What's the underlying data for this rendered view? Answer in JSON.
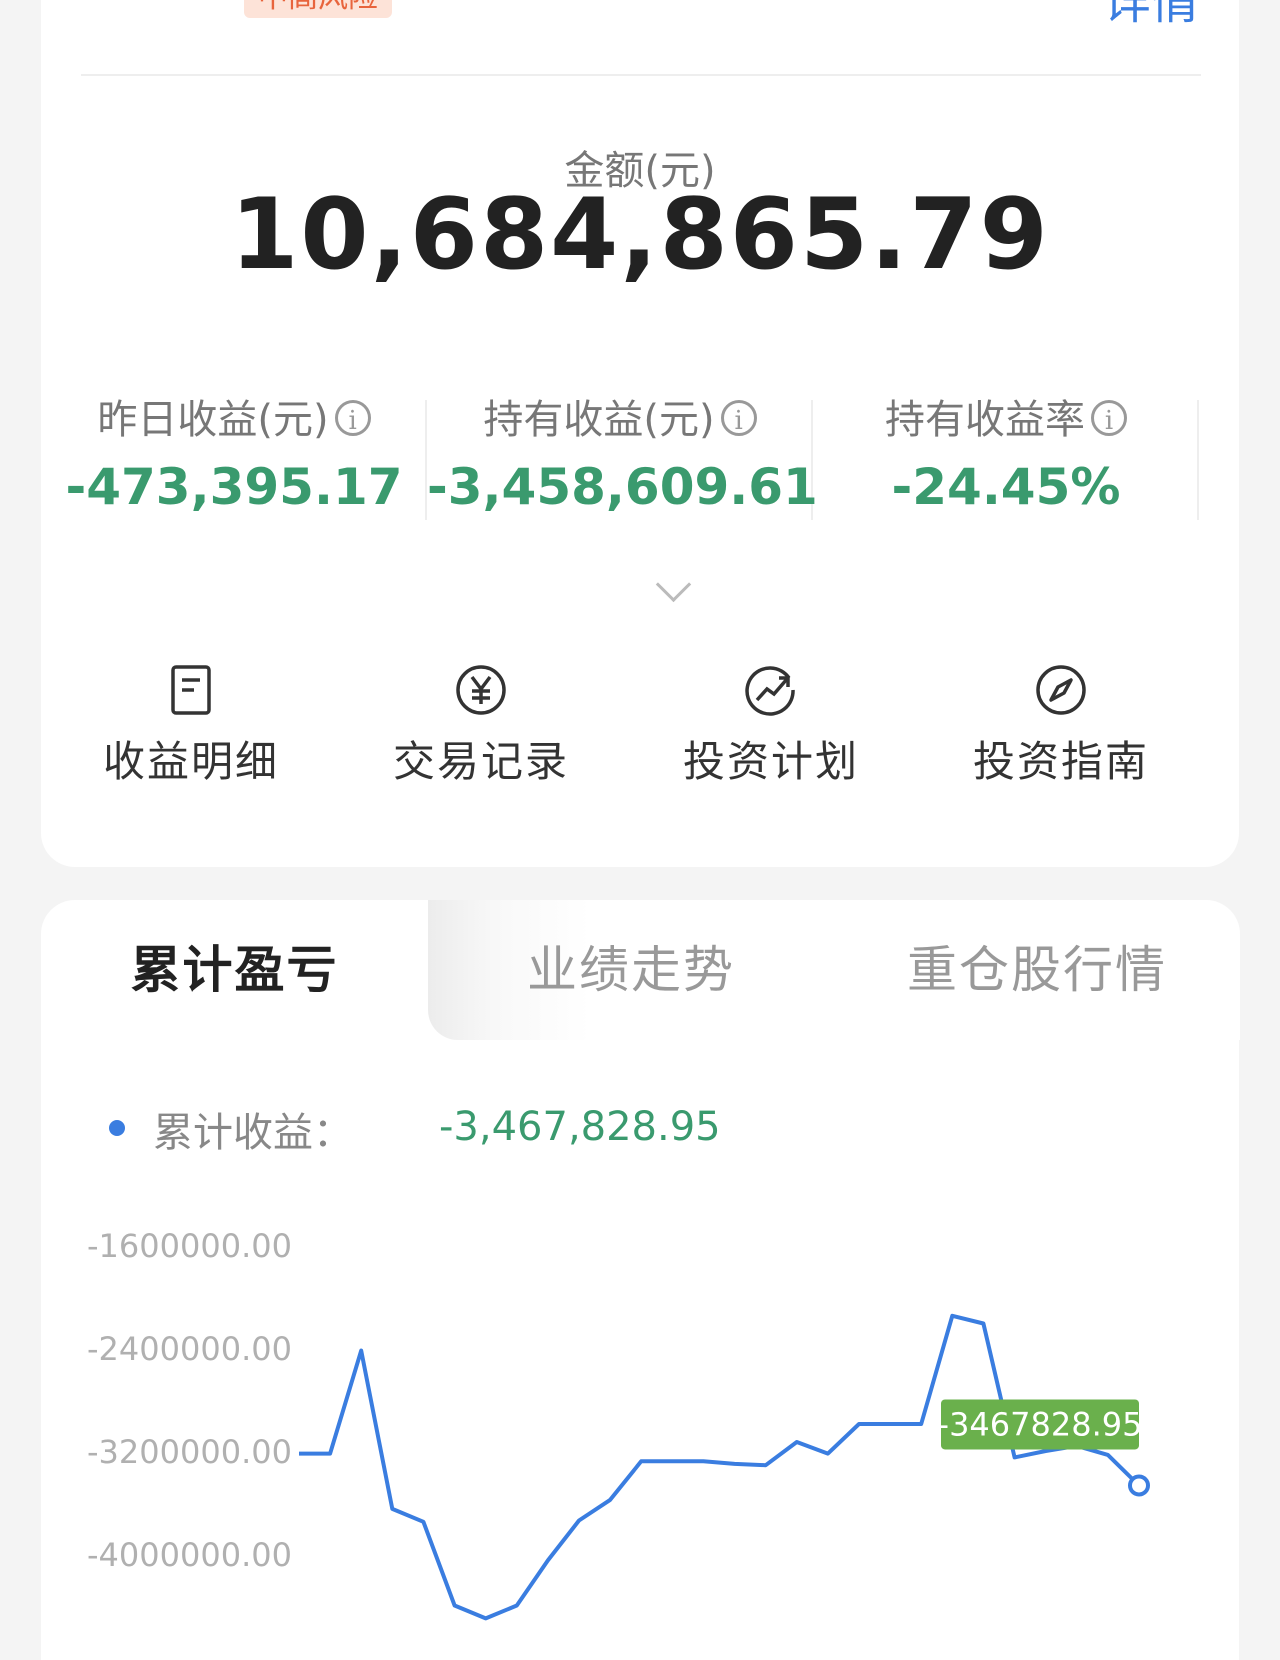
{
  "header": {
    "risk_badge": "中高风险",
    "detail_link": "详情"
  },
  "summary": {
    "amount_label": "金额(元)",
    "amount_value": "10,684,865.79",
    "stats": [
      {
        "label": "昨日收益(元)",
        "value": "-473,395.17"
      },
      {
        "label": "持有收益(元)",
        "value": "-3,458,609.61"
      },
      {
        "label": "持有收益率",
        "value": "-24.45%"
      }
    ]
  },
  "actions": [
    {
      "label": "收益明细",
      "icon": "document-icon"
    },
    {
      "label": "交易记录",
      "icon": "yen-circle-icon"
    },
    {
      "label": "投资计划",
      "icon": "trend-up-icon"
    },
    {
      "label": "投资指南",
      "icon": "compass-icon"
    }
  ],
  "tabs": [
    {
      "label": "累计盈亏",
      "active": true
    },
    {
      "label": "业绩走势",
      "active": false
    },
    {
      "label": "重仓股行情",
      "active": false
    }
  ],
  "colors": {
    "loss_green": "#3a9a6e",
    "accent_blue": "#3a7de0",
    "tooltip_green": "#6ab04c"
  },
  "chart_data": {
    "type": "line",
    "legend_label": "累计收益：",
    "legend_value": "-3,467,828.95",
    "y_ticks": [
      "-1600000.00",
      "-2400000.00",
      "-3200000.00",
      "-4000000.00"
    ],
    "ylim": [
      -4600000,
      -1200000
    ],
    "tooltip": "-3467828.95",
    "series": [
      {
        "values": [
          -3220000,
          -3220000,
          -2420000,
          -3650000,
          -3750000,
          -4400000,
          -4500000,
          -4400000,
          -4050000,
          -3740000,
          -3580000,
          -3280000,
          -3280000,
          -3280000,
          -3300000,
          -3310000,
          -3130000,
          -3220000,
          -2990000,
          -2990000,
          -2990000,
          -2150000,
          -2210000,
          -3250000,
          -3200000,
          -3160000,
          -3230000,
          -3467828.95
        ]
      }
    ]
  }
}
